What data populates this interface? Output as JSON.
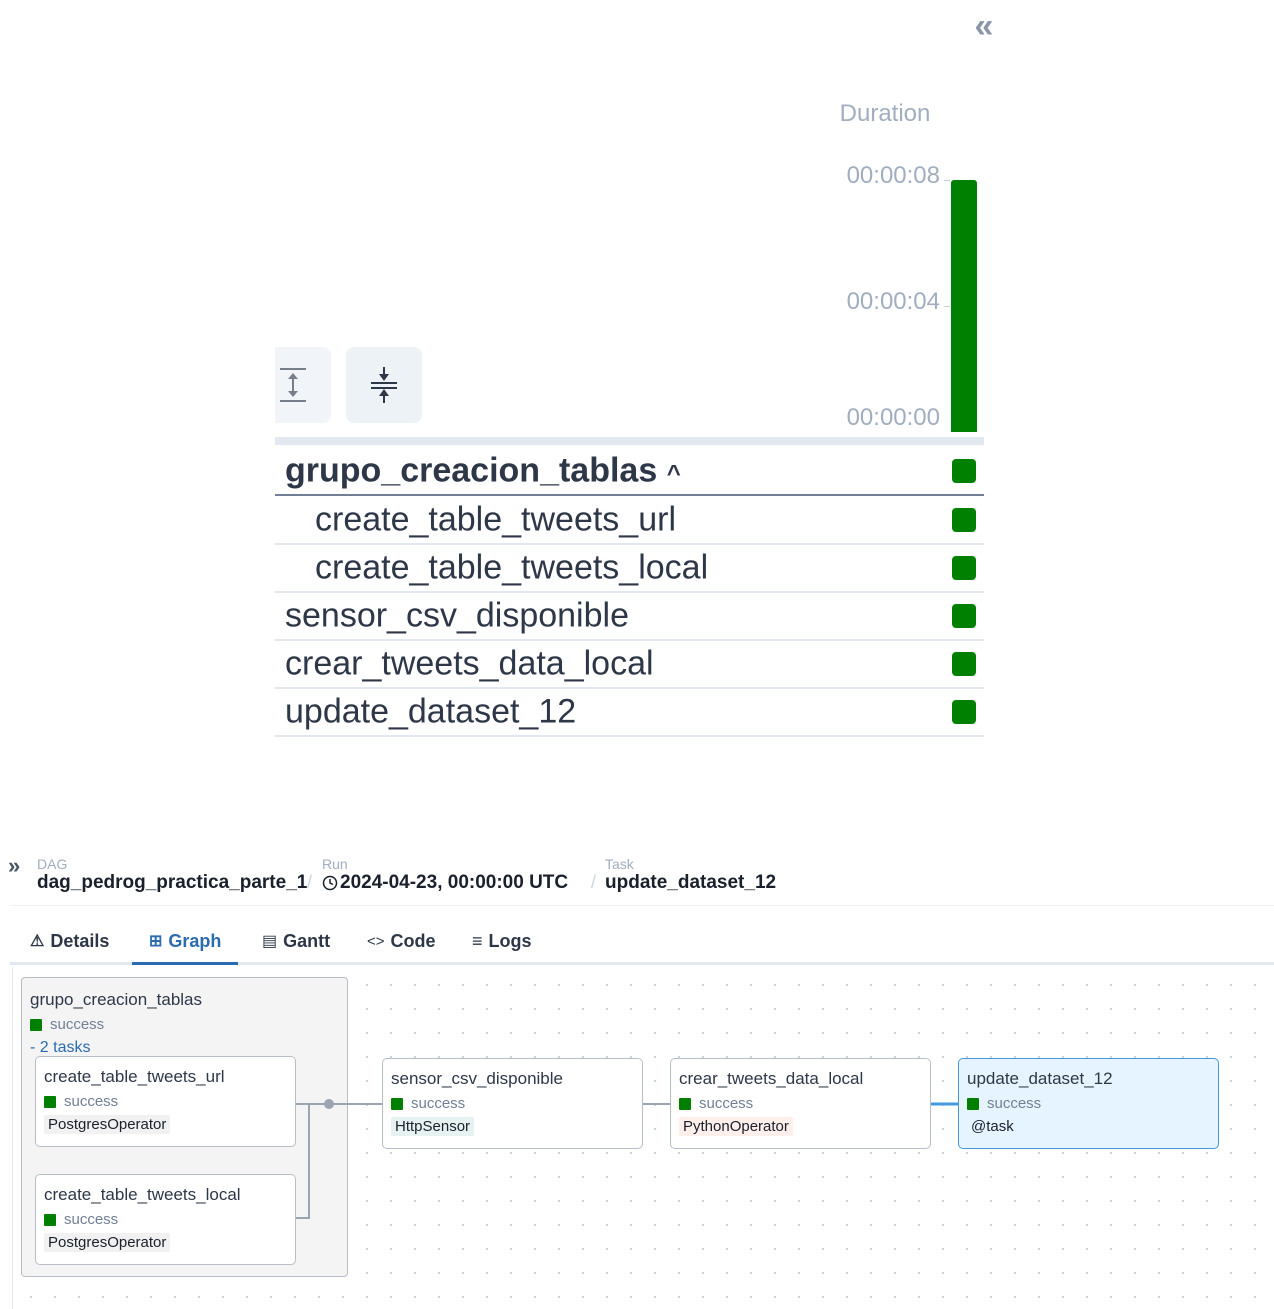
{
  "grid": {
    "collapse_icon": "«",
    "duration_label": "Duration",
    "ticks": [
      "00:00:08",
      "00:00:04",
      "00:00:00"
    ],
    "rows": [
      {
        "name": "grupo_creacion_tablas",
        "caret": "^",
        "state": "success"
      },
      {
        "name": "create_table_tweets_url",
        "state": "success"
      },
      {
        "name": "create_table_tweets_local",
        "state": "success"
      },
      {
        "name": "sensor_csv_disponible",
        "state": "success"
      },
      {
        "name": "crear_tweets_data_local",
        "state": "success"
      },
      {
        "name": "update_dataset_12",
        "state": "success"
      }
    ],
    "success_color": "#008000"
  },
  "breadcrumb": {
    "arrow": "»",
    "dag_label": "DAG",
    "dag_value": "dag_pedrog_practica_parte_1",
    "run_label": "Run",
    "run_value": "2024-04-23, 00:00:00 UTC",
    "task_label": "Task",
    "task_value": "update_dataset_12",
    "sep": "/"
  },
  "tabs": [
    {
      "icon": "⚠",
      "label": "Details"
    },
    {
      "icon": "⊞",
      "label": "Graph",
      "active": true
    },
    {
      "icon": "▤",
      "label": "Gantt"
    },
    {
      "icon": "<>",
      "label": "Code"
    },
    {
      "icon": "≡",
      "label": "Logs"
    }
  ],
  "graph": {
    "group": {
      "title": "grupo_creacion_tablas",
      "status": "success",
      "tasks_toggle": "- 2 tasks"
    },
    "nodes": {
      "url": {
        "title": "create_table_tweets_url",
        "status": "success",
        "operator": "PostgresOperator",
        "op_color": "#f1f1f1"
      },
      "local": {
        "title": "create_table_tweets_local",
        "status": "success",
        "operator": "PostgresOperator",
        "op_color": "#f1f1f1"
      },
      "sensor": {
        "title": "sensor_csv_disponible",
        "status": "success",
        "operator": "HttpSensor",
        "op_color": "#e6f1f2"
      },
      "crear": {
        "title": "crear_tweets_data_local",
        "status": "success",
        "operator": "PythonOperator",
        "op_color": "#ffefeb"
      },
      "update": {
        "title": "update_dataset_12",
        "status": "success",
        "operator": "@task",
        "op_color": "#e6f4ff"
      }
    }
  }
}
